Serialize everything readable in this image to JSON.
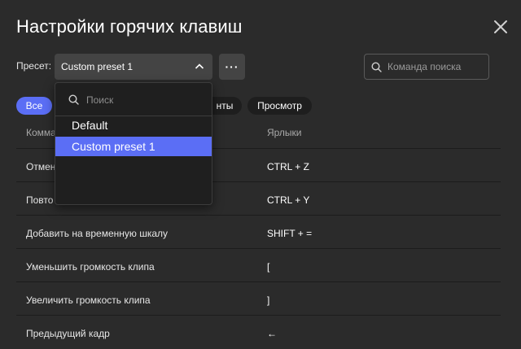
{
  "dialog": {
    "title": "Настройки горячих клавиш"
  },
  "preset": {
    "label": "Пресет:",
    "selected": "Custom preset 1",
    "more_label": "···"
  },
  "search": {
    "placeholder": "Команда поиска"
  },
  "tabs": [
    {
      "label": "Все",
      "active": true
    },
    {
      "label": "нты",
      "active": false
    },
    {
      "label": "Просмотр",
      "active": false
    }
  ],
  "table": {
    "headers": {
      "command": "Комма",
      "shortcut": "Ярлыки"
    },
    "rows": [
      {
        "command": "Отмен",
        "shortcut": "CTRL + Z"
      },
      {
        "command": "Повто",
        "shortcut": "CTRL + Y"
      },
      {
        "command": "Добавить на временную шкалу",
        "shortcut": "SHIFT + ="
      },
      {
        "command": "Уменьшить громкость клипа",
        "shortcut": "["
      },
      {
        "command": "Увеличить громкость клипа",
        "shortcut": "]"
      },
      {
        "command": "Предыдущий кадр",
        "shortcut": "←"
      }
    ]
  },
  "dropdown": {
    "search_placeholder": "Поиск",
    "options": [
      {
        "label": "Default",
        "selected": false
      },
      {
        "label": "Custom preset 1",
        "selected": true
      }
    ]
  },
  "colors": {
    "accent": "#5b6ef5",
    "background": "#2b2b2b"
  },
  "icons": [
    "close-icon",
    "chevron-up-icon",
    "search-icon"
  ]
}
